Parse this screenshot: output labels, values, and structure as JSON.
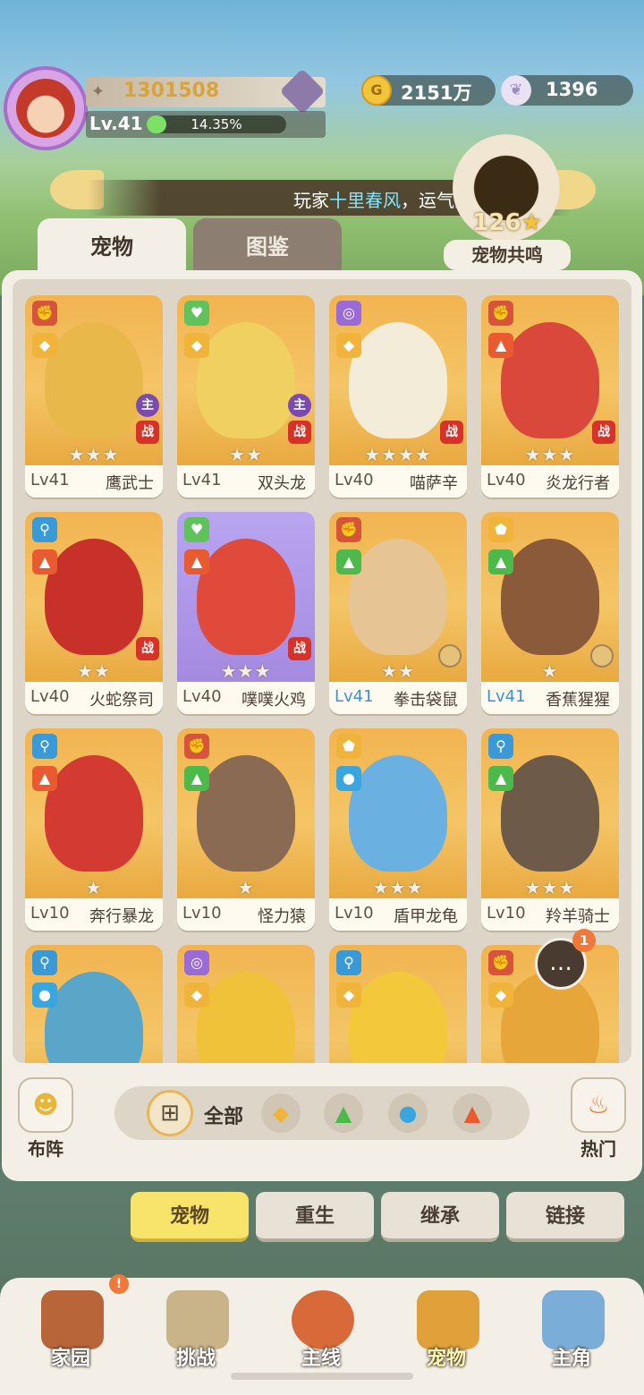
{
  "player": {
    "power": "1301508",
    "level": "Lv.41",
    "exp_percent": "14.35%",
    "exp_fill": 0.1435
  },
  "currency": {
    "gold": "2151万",
    "shells": "1396"
  },
  "resonance": {
    "value": "126",
    "star": "★",
    "label": "宠物共鸣"
  },
  "ticker": {
    "prefix": "玩家",
    "player": "十里春风",
    "suffix": "，运气满满，在寻"
  },
  "tabs": {
    "pets": "宠物",
    "codex": "图鉴"
  },
  "pets": [
    {
      "level": "Lv41",
      "name": "鹰武士",
      "stars": "★★★",
      "main": "主",
      "battle": "战"
    },
    {
      "level": "Lv41",
      "name": "双头龙",
      "stars": "★★",
      "main": "主",
      "battle": "战"
    },
    {
      "level": "Lv40",
      "name": "喵萨辛",
      "stars": "★★★★",
      "battle": "战"
    },
    {
      "level": "Lv40",
      "name": "炎龙行者",
      "stars": "★★★",
      "battle": "战"
    },
    {
      "level": "Lv40",
      "name": "火蛇祭司",
      "stars": "★★",
      "battle": "战"
    },
    {
      "level": "Lv40",
      "name": "噗噗火鸡",
      "stars": "★★★",
      "battle": "战"
    },
    {
      "level": "Lv41",
      "name": "拳击袋鼠",
      "stars": "★★"
    },
    {
      "level": "Lv41",
      "name": "香蕉猩猩",
      "stars": "★"
    },
    {
      "level": "Lv10",
      "name": "奔行暴龙",
      "stars": "★"
    },
    {
      "level": "Lv10",
      "name": "怪力猿",
      "stars": "★"
    },
    {
      "level": "Lv10",
      "name": "盾甲龙龟",
      "stars": "★★★"
    },
    {
      "level": "Lv10",
      "name": "羚羊骑士",
      "stars": "★★★"
    }
  ],
  "filters": {
    "lineup": "布阵",
    "all": "全部",
    "hot": "热门"
  },
  "chat_badge": "1",
  "subtabs": [
    "宠物",
    "重生",
    "继承",
    "链接"
  ],
  "nav": [
    {
      "label": "家园",
      "badge": "!"
    },
    {
      "label": "挑战"
    },
    {
      "label": "主线"
    },
    {
      "label": "宠物"
    },
    {
      "label": "主角"
    }
  ],
  "colors": {
    "accent": "#f9e46b",
    "battle_red": "#d6322a",
    "main_purple": "#7a4ab0"
  }
}
